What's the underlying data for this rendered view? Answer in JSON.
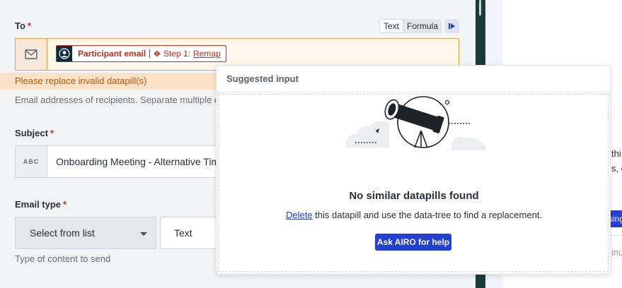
{
  "form": {
    "to": {
      "label": "To",
      "required_mark": "*",
      "mode_text": "Text",
      "mode_formula": "Formula",
      "pill": {
        "name": "Participant email",
        "step": "Step 1:",
        "action": "Remap"
      },
      "error": "Please replace invalid datapill(s)",
      "hint": "Email addresses of recipients. Separate multiple e"
    },
    "subject": {
      "label": "Subject",
      "required_mark": "*",
      "prefix": "ABC",
      "value": "Onboarding Meeting - Alternative Time"
    },
    "email_type": {
      "label": "Email type",
      "required_mark": "*",
      "select_value": "Select from list",
      "text_value": "Text",
      "hint": "Type of content to send"
    }
  },
  "suggest": {
    "title": "Suggested input",
    "empty_title": "No similar datapills found",
    "delete_link": "Delete",
    "description_rest": " this datapill and use the data-tree to find a replacement.",
    "ask_button": "Ask AIRO for help"
  },
  "right_panel": {
    "line1": "thi",
    "line2": "s, c",
    "button": "sing",
    "line3": "inu"
  },
  "colors": {
    "accent": "#2340d4",
    "error": "#b8321f",
    "warning_bg": "#fbe1c5"
  }
}
